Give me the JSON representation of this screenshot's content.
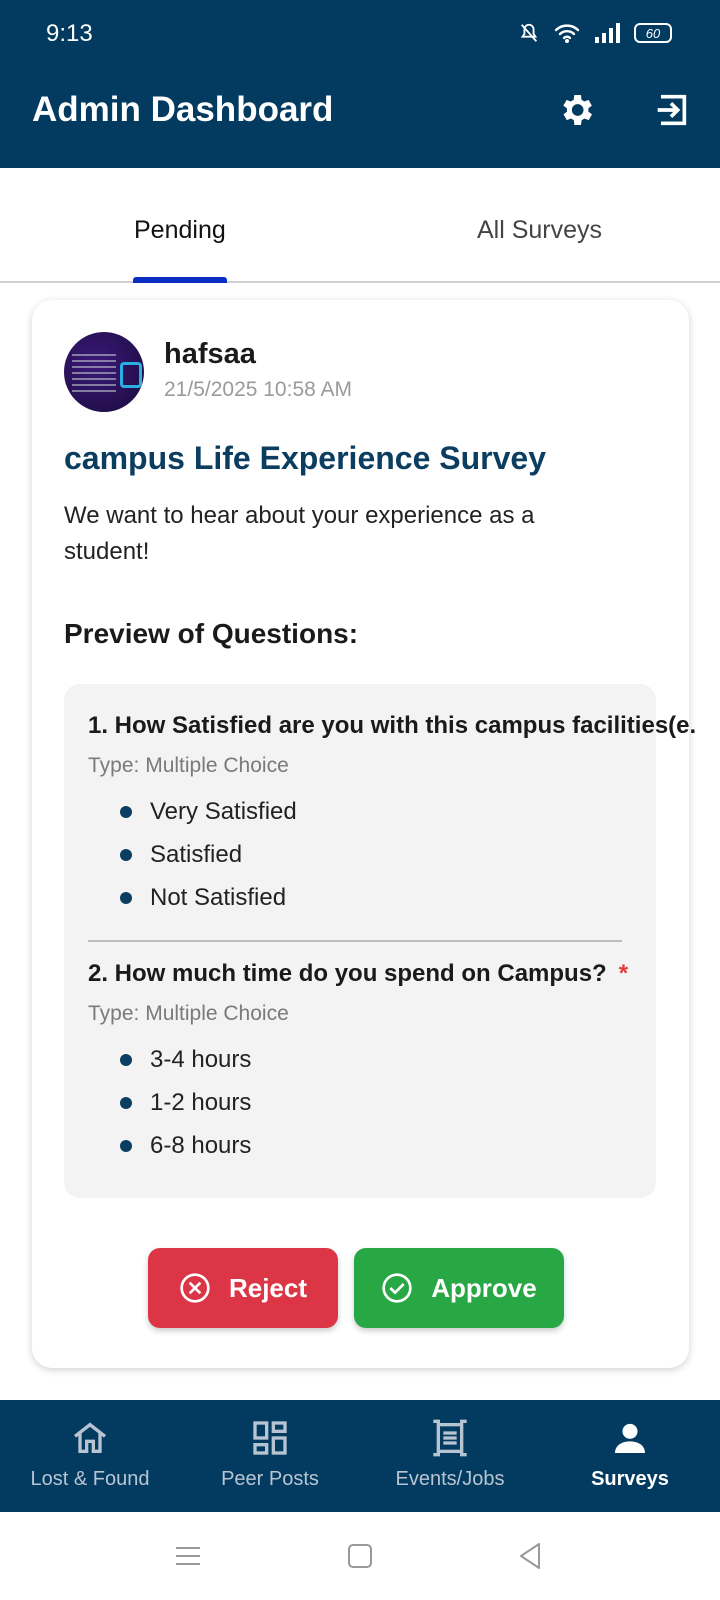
{
  "status_bar": {
    "time": "9:13",
    "battery": "60"
  },
  "header": {
    "title": "Admin Dashboard"
  },
  "tabs": [
    {
      "label": "Pending"
    },
    {
      "label": "All Surveys"
    }
  ],
  "survey": {
    "author": "hafsaa",
    "date": "21/5/2025 10:58 AM",
    "title": "campus Life Experience Survey",
    "description": "We want to hear about your experience as a student!",
    "preview_heading": "Preview of Questions:",
    "questions": [
      {
        "text": "1. How Satisfied are you with this campus facilities(e.",
        "type": "Type: Multiple Choice",
        "options": [
          "Very Satisfied",
          "Satisfied",
          "Not Satisfied"
        ]
      },
      {
        "text": "2. How much time do you spend on Campus?",
        "required_mark": "*",
        "type": "Type: Multiple Choice",
        "options": [
          "3-4 hours",
          "1-2 hours",
          "6-8 hours"
        ]
      }
    ],
    "reject_label": "Reject",
    "approve_label": "Approve"
  },
  "bottom_nav": [
    {
      "label": "Lost & Found",
      "icon": "home-icon"
    },
    {
      "label": "Peer Posts",
      "icon": "dashboard-icon"
    },
    {
      "label": "Events/Jobs",
      "icon": "document-icon"
    },
    {
      "label": "Surveys",
      "icon": "person-icon",
      "active": true
    }
  ],
  "colors": {
    "primary": "#033a5f",
    "tab_indicator": "#0a2ec4",
    "reject": "#dc3545",
    "approve": "#28a745",
    "required": "#e53935"
  }
}
